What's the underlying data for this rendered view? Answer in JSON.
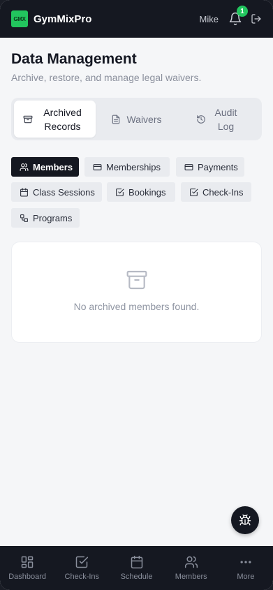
{
  "header": {
    "logo_text": "GMX",
    "app_name": "GymMixPro",
    "user_name": "Mike",
    "notification_count": "1"
  },
  "page": {
    "title": "Data Management",
    "subtitle": "Archive, restore, and manage legal waivers."
  },
  "tabs": [
    {
      "label": "Archived Records",
      "icon": "archive-icon",
      "active": true
    },
    {
      "label": "Waivers",
      "icon": "document-icon",
      "active": false
    },
    {
      "label": "Audit Log",
      "icon": "history-icon",
      "active": false
    }
  ],
  "record_types": [
    {
      "label": "Members",
      "icon": "users-icon",
      "active": true
    },
    {
      "label": "Memberships",
      "icon": "card-icon",
      "active": false
    },
    {
      "label": "Payments",
      "icon": "card-icon",
      "active": false
    },
    {
      "label": "Class Sessions",
      "icon": "calendar-icon",
      "active": false
    },
    {
      "label": "Bookings",
      "icon": "check-square-icon",
      "active": false
    },
    {
      "label": "Check-Ins",
      "icon": "check-square-icon",
      "active": false
    },
    {
      "label": "Programs",
      "icon": "workflow-icon",
      "active": false
    }
  ],
  "empty_state": {
    "message": "No archived members found.",
    "icon": "archive-icon"
  },
  "fab": {
    "icon": "bug-icon"
  },
  "bottom_nav": [
    {
      "label": "Dashboard",
      "icon": "grid-icon"
    },
    {
      "label": "Check-Ins",
      "icon": "check-square-icon"
    },
    {
      "label": "Schedule",
      "icon": "calendar-icon"
    },
    {
      "label": "Members",
      "icon": "users-icon"
    },
    {
      "label": "More",
      "icon": "more-icon"
    }
  ],
  "colors": {
    "accent": "#22c55e",
    "dark": "#151821",
    "background": "#f5f6f8"
  }
}
